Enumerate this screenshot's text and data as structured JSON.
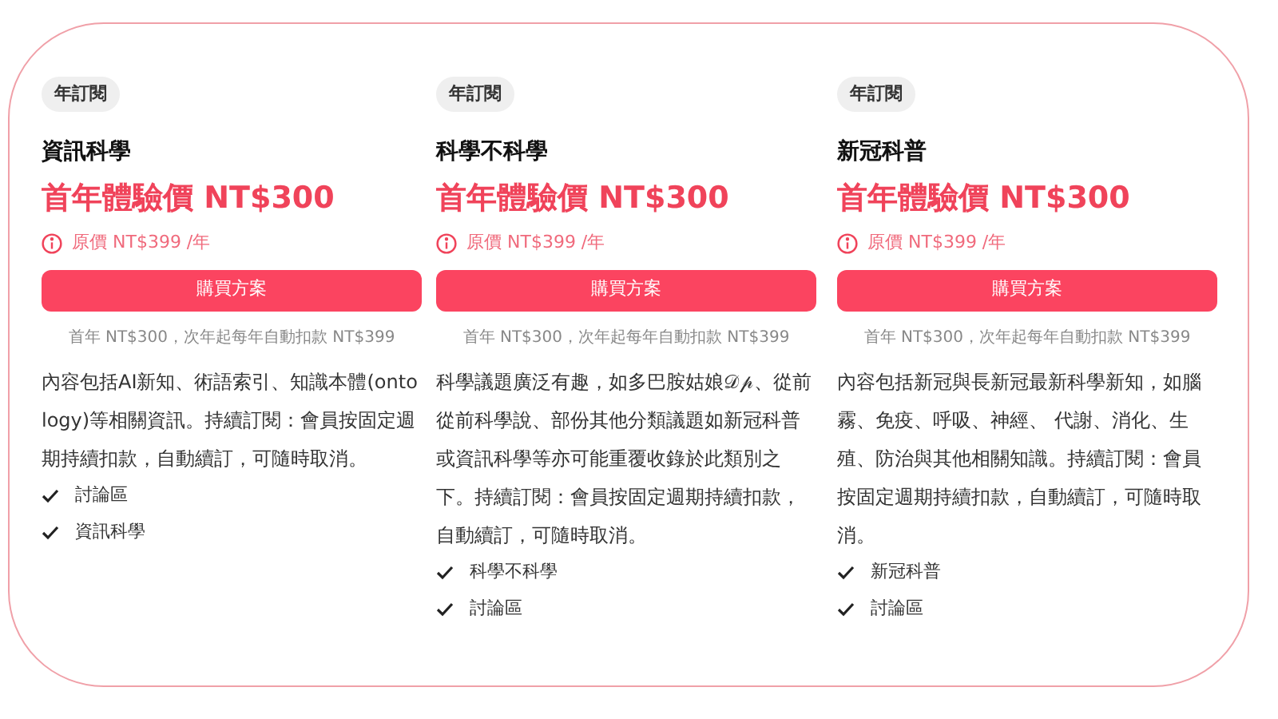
{
  "plans": [
    {
      "badge": "年訂閱",
      "title": "資訊科學",
      "price": "首年體驗價 NT$300",
      "original_price": "原價 NT$399 /年",
      "button": "購買方案",
      "note": "首年 NT$300，次年起每年自動扣款 NT$399",
      "description": "內容包括AI新知、術語索引、知識本體(ontology)等相關資訊。持續訂閱：會員按固定週期持續扣款，自動續訂，可隨時取消。",
      "features": [
        "討論區",
        "資訊科學"
      ]
    },
    {
      "badge": "年訂閱",
      "title": "科學不科學",
      "price": "首年體驗價 NT$300",
      "original_price": "原價 NT$399 /年",
      "button": "購買方案",
      "note": "首年 NT$300，次年起每年自動扣款 NT$399",
      "description": "科學議題廣泛有趣，如多巴胺姑娘𝒟𝓅、從前從前科學說、部份其他分類議題如新冠科普或資訊科學等亦可能重覆收錄於此類別之下。持續訂閱：會員按固定週期持續扣款，自動續訂，可隨時取消。",
      "features": [
        "科學不科學",
        "討論區"
      ]
    },
    {
      "badge": "年訂閱",
      "title": "新冠科普",
      "price": "首年體驗價 NT$300",
      "original_price": "原價 NT$399 /年",
      "button": "購買方案",
      "note": "首年 NT$300，次年起每年自動扣款 NT$399",
      "description": "內容包括新冠與長新冠最新科學新知，如腦霧、免疫、呼吸、神經、 代謝、消化、生殖、防治與其他相關知識。持續訂閱：會員按固定週期持續扣款，自動續訂，可隨時取消。",
      "features": [
        "新冠科普",
        "討論區"
      ]
    }
  ]
}
